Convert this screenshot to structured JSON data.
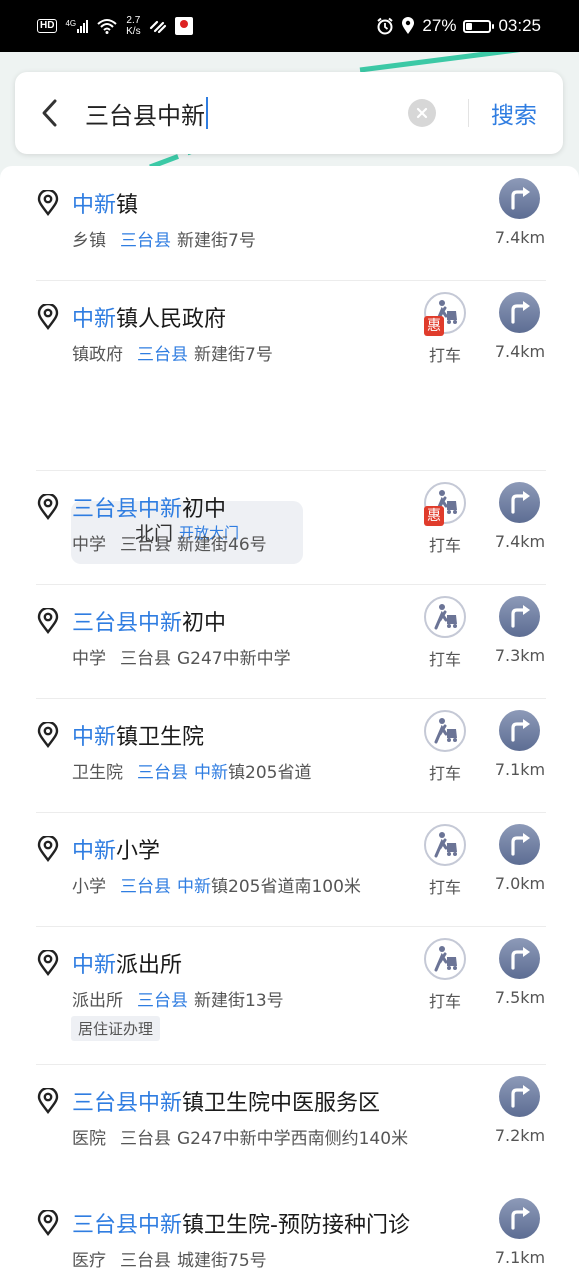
{
  "status_bar": {
    "hd": "HD",
    "net": "4G",
    "speed_value": "2.7",
    "speed_unit": "K/s",
    "battery": "27%",
    "battery_level": 0.27,
    "time": "03:25"
  },
  "search": {
    "query": "三台县中新",
    "button": "搜索"
  },
  "results": [
    {
      "name_hl": "中新",
      "name_rest": "镇",
      "category": "乡镇",
      "area": "三台县",
      "area_hl": true,
      "addr_hl": "",
      "addr_rest": "新建街7号",
      "taxi": false,
      "taxi_label": "",
      "distance": "7.4km"
    },
    {
      "name_hl": "中新",
      "name_rest": "镇人民政府",
      "category": "镇政府",
      "area": "三台县",
      "area_hl": true,
      "addr_hl": "",
      "addr_rest": "新建街7号",
      "taxi": true,
      "taxi_promo": "惠",
      "taxi_label": "打车",
      "distance": "7.4km",
      "gate": {
        "name": "北门",
        "note": "开放大门"
      }
    },
    {
      "name_hl": "三台县中新",
      "name_rest": "初中",
      "category": "中学",
      "area": "三台县",
      "area_hl": false,
      "addr_hl": "",
      "addr_rest": "新建街46号",
      "taxi": true,
      "taxi_promo": "惠",
      "taxi_label": "打车",
      "distance": "7.4km"
    },
    {
      "name_hl": "三台县中新",
      "name_rest": "初中",
      "category": "中学",
      "area": "三台县",
      "area_hl": false,
      "addr_hl": "",
      "addr_rest": "G247中新中学",
      "taxi": true,
      "taxi_label": "打车",
      "distance": "7.3km"
    },
    {
      "name_hl": "中新",
      "name_rest": "镇卫生院",
      "category": "卫生院",
      "area": "三台县",
      "area_hl": true,
      "addr_hl": "中新",
      "addr_rest": "镇205省道",
      "taxi": true,
      "taxi_label": "打车",
      "distance": "7.1km"
    },
    {
      "name_hl": "中新",
      "name_rest": "小学",
      "category": "小学",
      "area": "三台县",
      "area_hl": true,
      "addr_hl": "中新",
      "addr_rest": "镇205省道南100米",
      "taxi": true,
      "taxi_label": "打车",
      "distance": "7.0km"
    },
    {
      "name_hl": "中新",
      "name_rest": "派出所",
      "category": "派出所",
      "area": "三台县",
      "area_hl": true,
      "addr_hl": "",
      "addr_rest": "新建街13号",
      "taxi": true,
      "taxi_label": "打车",
      "distance": "7.5km",
      "tag": "居住证办理"
    },
    {
      "name_hl": "三台县中新",
      "name_rest": "镇卫生院中医服务区",
      "category": "医院",
      "area": "三台县",
      "area_hl": false,
      "addr_hl": "",
      "addr_rest": "G247中新中学西南侧约140米",
      "taxi": false,
      "taxi_label": "",
      "distance": "7.2km"
    },
    {
      "name_hl": "三台县中新",
      "name_rest": "镇卫生院-预防接种门诊",
      "category": "医疗",
      "area": "三台县",
      "area_hl": false,
      "addr_hl": "",
      "addr_rest": "城建街75号",
      "taxi": false,
      "taxi_label": "",
      "distance": "7.1km"
    }
  ]
}
